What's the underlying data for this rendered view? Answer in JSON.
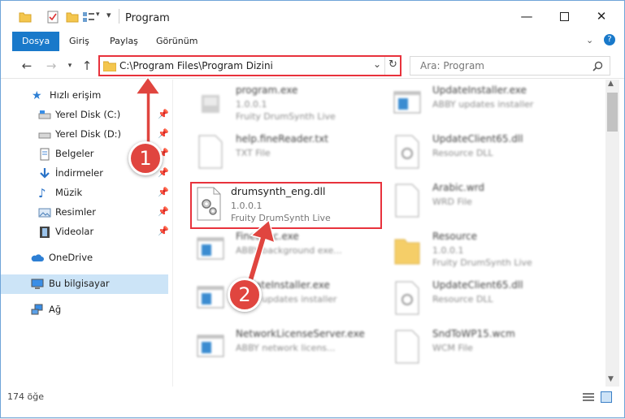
{
  "window": {
    "title": "Program"
  },
  "ribbon": {
    "tabs": [
      "Dosya",
      "Giriş",
      "Paylaş",
      "Görünüm"
    ]
  },
  "address": {
    "path": "C:\\Program Files\\Program Dizini"
  },
  "search": {
    "placeholder": "Ara: Program"
  },
  "sidebar": {
    "quick_access": "Hızlı erişim",
    "items": [
      {
        "label": "Yerel Disk (C:)",
        "icon": "drive-icon"
      },
      {
        "label": "Yerel Disk (D:)",
        "icon": "drive-icon"
      },
      {
        "label": "Belgeler",
        "icon": "documents-icon"
      },
      {
        "label": "İndirmeler",
        "icon": "downloads-icon"
      },
      {
        "label": "Müzik",
        "icon": "music-icon"
      },
      {
        "label": "Resimler",
        "icon": "pictures-icon"
      },
      {
        "label": "Videolar",
        "icon": "videos-icon"
      }
    ],
    "onedrive": "OneDrive",
    "this_pc": "Bu bilgisayar",
    "network": "Ağ"
  },
  "files": [
    {
      "name": "program.exe",
      "line2": "1.0.0.1",
      "line3": "Fruity DrumSynth Live",
      "icon": "exe-icon"
    },
    {
      "name": "UpdateInstaller.exe",
      "line2": "ABBY updates installer",
      "line3": "",
      "icon": "exe-window-icon"
    },
    {
      "name": "help.fineReader.txt",
      "line2": "TXT File",
      "line3": "",
      "icon": "text-file-icon"
    },
    {
      "name": "UpdateClient65.dll",
      "line2": "Resource DLL",
      "line3": "",
      "icon": "dll-icon"
    },
    {
      "name": "drumsynth_eng.dll",
      "line2": "1.0.0.1",
      "line3": "Fruity DrumSynth Live",
      "icon": "dll-gear-icon"
    },
    {
      "name": "Arabic.wrd",
      "line2": "WRD File",
      "line3": "",
      "icon": "blank-file-icon"
    },
    {
      "name": "FineExec.exe",
      "line2": "ABBY background exe...",
      "line3": "",
      "icon": "exe-window-icon"
    },
    {
      "name": "Resource",
      "line2": "1.0.0.1",
      "line3": "Fruity DrumSynth Live",
      "icon": "folder-icon"
    },
    {
      "name": "UpdateInstaller.exe",
      "line2": "ABBY updates installer",
      "line3": "",
      "icon": "exe-window-icon"
    },
    {
      "name": "UpdateClient65.dll",
      "line2": "Resource DLL",
      "line3": "",
      "icon": "dll-icon"
    },
    {
      "name": "NetworkLicenseServer.exe",
      "line2": "ABBY network licens...",
      "line3": "",
      "icon": "exe-window-icon"
    },
    {
      "name": "SndToWP15.wcm",
      "line2": "WCM File",
      "line3": "",
      "icon": "blank-file-icon"
    }
  ],
  "status": {
    "count": "174 öğe"
  },
  "annotations": {
    "step1": "1",
    "step2": "2"
  },
  "colors": {
    "accent": "#1979ca",
    "highlight": "#e8323c",
    "selected": "#cce4f7"
  }
}
